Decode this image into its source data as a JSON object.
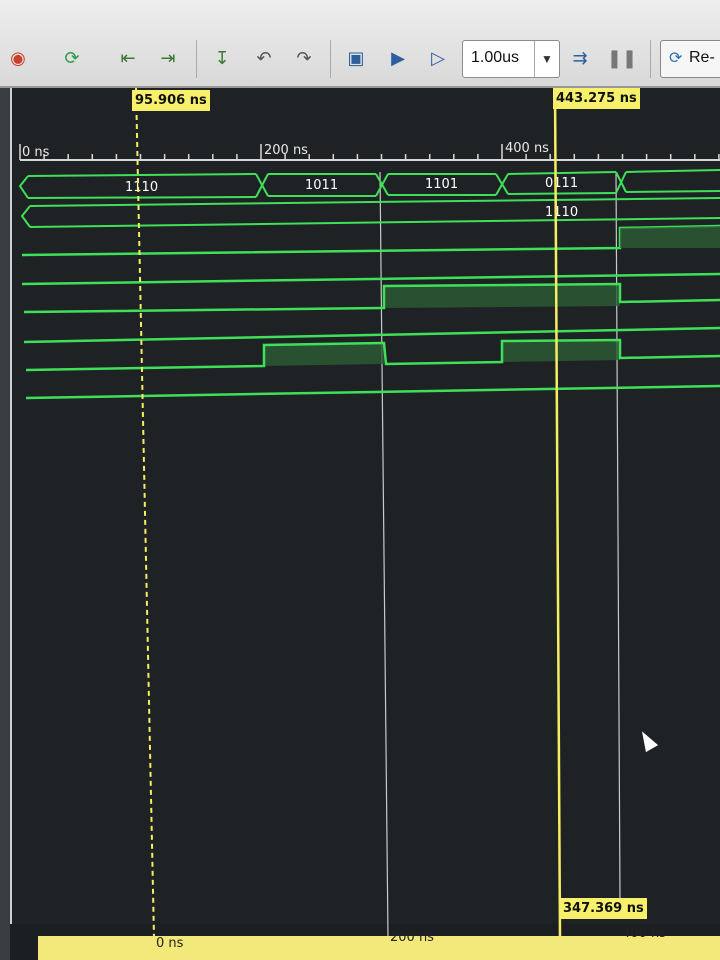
{
  "toolbar": {
    "run_time": "1.00us",
    "relaunch_label": "Re-"
  },
  "cursors": {
    "main_cursor_time": "443.275 ns",
    "marker_time": "95.906 ns",
    "delta_time": "347.369 ns"
  },
  "ruler": {
    "top_labels": [
      "0 ns",
      "200 ns",
      "400 ns"
    ],
    "bottom_labels": [
      "0 ns",
      "200 ns",
      "400 ns"
    ]
  },
  "signals": {
    "bus1_values": [
      "1110",
      "1011",
      "1101",
      "0111"
    ],
    "bus2_value": "1110"
  },
  "colors": {
    "wave": "#3ee05a",
    "cursor": "#f5ee60",
    "toolbar_bg": "#e4e4e4",
    "wave_bg": "#1f2224"
  }
}
